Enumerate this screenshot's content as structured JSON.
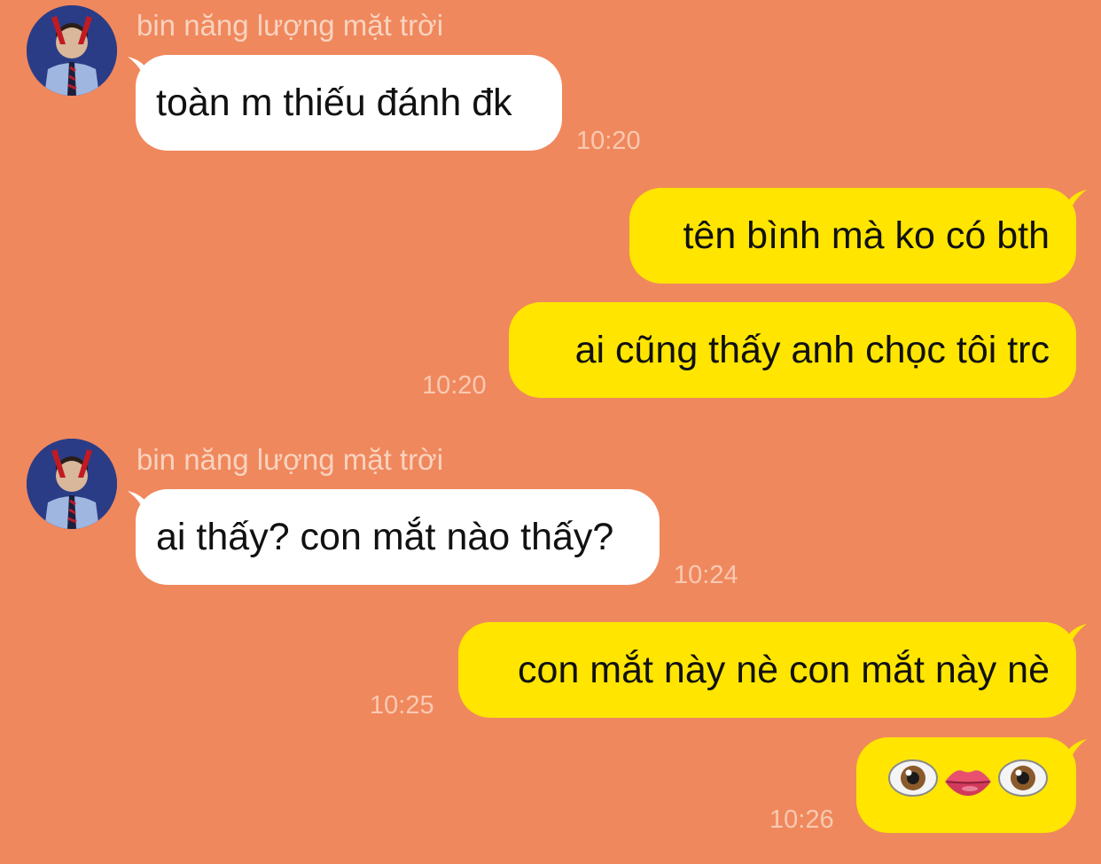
{
  "chat": {
    "sender_name": "bin năng lượng mặt trời",
    "messages": [
      {
        "side": "in",
        "text": "toàn m thiếu đánh đk",
        "time": "10:20"
      },
      {
        "side": "out",
        "text": "tên bình mà ko có bth",
        "time": ""
      },
      {
        "side": "out",
        "text": "ai cũng thấy anh chọc tôi trc",
        "time": "10:20"
      },
      {
        "side": "in",
        "text": "ai thấy? con mắt nào thấy?",
        "time": "10:24"
      },
      {
        "side": "out",
        "text": "con mắt này nè con mắt này nè",
        "time": "10:25"
      },
      {
        "side": "out",
        "text": "",
        "emoji": [
          "eye-icon",
          "lips-icon",
          "eye-icon"
        ],
        "time": "10:26"
      }
    ]
  },
  "colors": {
    "background": "#F0885D",
    "incoming_bubble": "#FFFFFF",
    "outgoing_bubble": "#FFE500",
    "timestamp": "#F8C9B2",
    "sender_name": "#F8D3BF"
  }
}
